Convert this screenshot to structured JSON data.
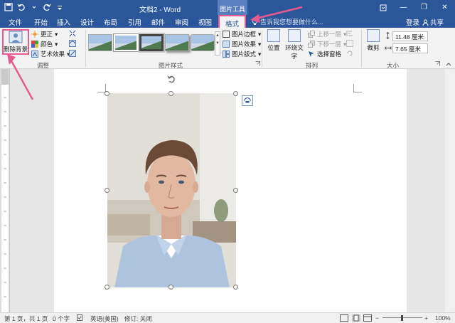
{
  "titlebar": {
    "document_title": "文档2 - Word",
    "context_header": "图片工具",
    "minimize": "—",
    "restore": "❐",
    "close": "✕"
  },
  "tabs": [
    {
      "label": "文件"
    },
    {
      "label": "开始"
    },
    {
      "label": "插入"
    },
    {
      "label": "设计"
    },
    {
      "label": "布局"
    },
    {
      "label": "引用"
    },
    {
      "label": "邮件"
    },
    {
      "label": "审阅"
    },
    {
      "label": "视图"
    },
    {
      "label": "格式"
    }
  ],
  "tell_me": "告诉我您想要做什么...",
  "account": {
    "login": "登录",
    "share": "共享"
  },
  "ribbon": {
    "adjust": {
      "remove_background": "删除背景",
      "corrections": "更正",
      "color": "颜色",
      "artistic_effects": "艺术效果",
      "group_label": "调整"
    },
    "picture_styles": {
      "border": "图片边框",
      "effects": "图片效果",
      "layout": "图片版式",
      "group_label": "图片样式"
    },
    "arrange": {
      "position": "位置",
      "wrap_text": "环绕文字",
      "bring_forward": "上移一层",
      "send_backward": "下移一层",
      "selection_pane": "选择窗格",
      "group_label": "排列"
    },
    "size": {
      "crop": "裁剪",
      "height": "11.48 厘米",
      "width": "7.65 厘米",
      "group_label": "大小"
    }
  },
  "statusbar": {
    "page": "第 1 页，共 1 页",
    "words": "0 个字",
    "language": "英语(美国)",
    "track_changes": "修订: 关闭",
    "zoom": "100%"
  },
  "colors": {
    "word_blue": "#2b579a",
    "annotation_pink": "#e85a8f"
  }
}
